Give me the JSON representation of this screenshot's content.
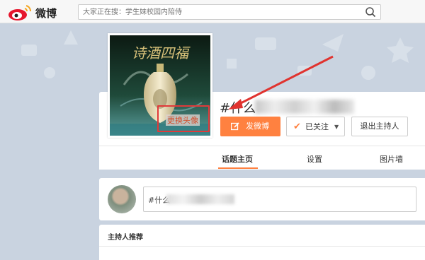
{
  "app": {
    "logo_text": "微博"
  },
  "search": {
    "placeholder": "大家正在搜：学生妹校园内陪侍"
  },
  "topic": {
    "title_prefix": "#什么"
  },
  "profile": {
    "change_avatar_label": "更换头像"
  },
  "actions": {
    "post_label": "发微博",
    "follow_label": "已关注",
    "exit_host_label": "退出主持人"
  },
  "tabs": [
    {
      "label": "话题主页",
      "active": true
    },
    {
      "label": "设置",
      "active": false
    },
    {
      "label": "图片墙",
      "active": false
    }
  ],
  "composer": {
    "prefix": "#什么"
  },
  "sections": {
    "host_recommend": "主持人推荐"
  },
  "colors": {
    "accent": "#ff8140",
    "highlight_box": "#e03a3a",
    "arrow": "#e0332f",
    "background": "#c9d3e0"
  },
  "icons": [
    "weibo-logo-icon",
    "search-icon",
    "edit-icon",
    "check-icon",
    "caret-down-icon"
  ]
}
